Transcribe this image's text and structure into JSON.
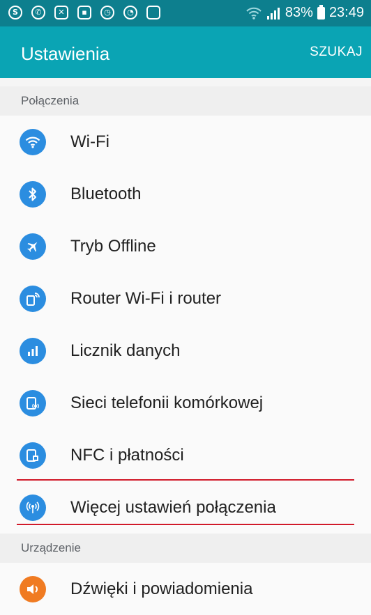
{
  "status_bar": {
    "icons": [
      "skype-icon",
      "whatsapp-icon",
      "mail-icon",
      "gallery-icon",
      "timer-icon",
      "alarm-icon",
      "clipboard-icon"
    ],
    "battery": "83%",
    "time": "23:49"
  },
  "app_bar": {
    "title": "Ustawienia",
    "search_label": "SZUKAJ"
  },
  "sections": [
    {
      "header": "Połączenia",
      "items": [
        {
          "label": "Wi-Fi",
          "icon": "wifi-icon"
        },
        {
          "label": "Bluetooth",
          "icon": "bluetooth-icon"
        },
        {
          "label": "Tryb Offline",
          "icon": "airplane-icon"
        },
        {
          "label": "Router Wi-Fi i router",
          "icon": "hotspot-icon"
        },
        {
          "label": "Licznik danych",
          "icon": "data-usage-icon"
        },
        {
          "label": "Sieci telefonii komórkowej",
          "icon": "mobile-network-icon"
        },
        {
          "label": "NFC i płatności",
          "icon": "nfc-icon"
        },
        {
          "label": "Więcej ustawień połączenia",
          "icon": "more-connections-icon",
          "highlighted": true
        }
      ]
    },
    {
      "header": "Urządzenie",
      "items": [
        {
          "label": "Dźwięki i powiadomienia",
          "icon": "sound-icon"
        }
      ]
    }
  ],
  "colors": {
    "status_bar": "#0d7f8e",
    "app_bar": "#0aa4b4",
    "icon_blue": "#2b8de0",
    "icon_orange": "#f07b22",
    "highlight_line": "#d11a2a"
  }
}
